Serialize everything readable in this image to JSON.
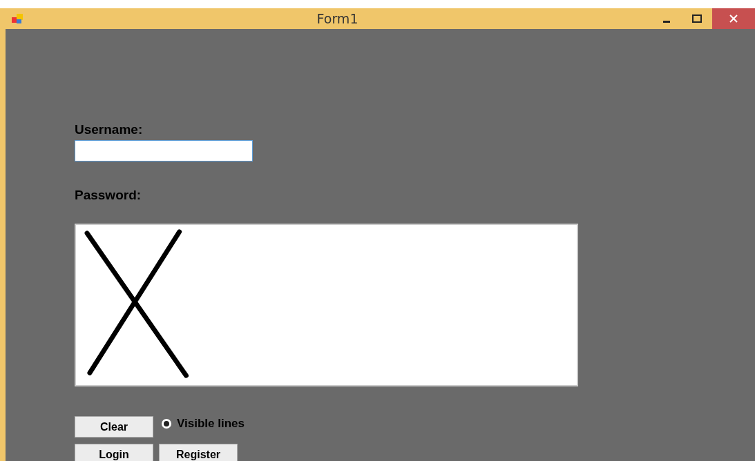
{
  "window": {
    "title": "Form1"
  },
  "username": {
    "label": "Username:"
  },
  "password": {
    "label": "Password:"
  },
  "buttons": {
    "clear": "Clear",
    "login": "Login",
    "register": "Register"
  },
  "option": {
    "label": "Visible lines",
    "selected": true
  }
}
